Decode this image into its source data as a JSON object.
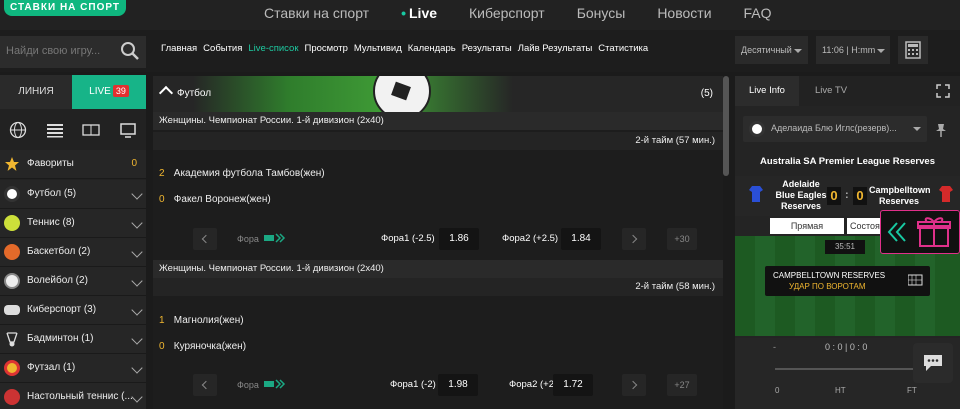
{
  "header": {
    "logo": "СТАВКИ НА СПОРТ",
    "nav": [
      "Ставки на спорт",
      "Live",
      "Киберспорт",
      "Бонусы",
      "Новости",
      "FAQ"
    ]
  },
  "search": {
    "placeholder": "Найди свою игру..."
  },
  "subnav": [
    "Главная",
    "События",
    "Live-список",
    "Просмотр",
    "Мультивид",
    "Календарь",
    "Результаты",
    "Лайв Результаты",
    "Статистика"
  ],
  "settings": {
    "odds_format": "Десятичный",
    "time_format": "11:06 | H:mm"
  },
  "sidebar": {
    "tab_line": "ЛИНИЯ",
    "tab_live": "LIVE",
    "live_count": "39",
    "sports": [
      {
        "name": "Фавориты",
        "count": "0",
        "icon": "star-icon"
      },
      {
        "name": "Футбол (5)",
        "icon": "football-icon"
      },
      {
        "name": "Теннис (8)",
        "icon": "tennis-icon"
      },
      {
        "name": "Баскетбол (2)",
        "icon": "basketball-icon"
      },
      {
        "name": "Волейбол (2)",
        "icon": "volleyball-icon"
      },
      {
        "name": "Киберспорт (3)",
        "icon": "gamepad-icon"
      },
      {
        "name": "Бадминтон (1)",
        "icon": "shuttlecock-icon"
      },
      {
        "name": "Футзал (1)",
        "icon": "futsal-icon"
      },
      {
        "name": "Настольный теннис (...",
        "icon": "table-tennis-icon"
      }
    ]
  },
  "main": {
    "sport_title": "Футбол",
    "sport_count": "(5)",
    "matches": [
      {
        "league": "Женщины. Чемпионат России. 1-й дивизион (2х40)",
        "period": "2-й тайм   (57 мин.)",
        "team1_score": "2",
        "team1": "Академия футбола Тамбов(жен)",
        "team2_score": "0",
        "team2": "Факел Воронеж(жен)",
        "market": "Фора",
        "h1_label": "Фора1 (-2.5)",
        "h1_odd": "1.86",
        "h2_label": "Фора2 (+2.5)",
        "h2_odd": "1.84",
        "more": "+30"
      },
      {
        "league": "Женщины. Чемпионат России. 1-й дивизион (2х40)",
        "period": "2-й тайм   (58 мин.)",
        "team1_score": "1",
        "team1": "Магнолия(жен)",
        "team2_score": "0",
        "team2": "Куряночка(жен)",
        "market": "Фора",
        "h1_label": "Фора1 (-2)",
        "h1_odd": "1.98",
        "h2_label": "Фора2 (+2)",
        "h2_odd": "1.72",
        "more": "+27"
      }
    ]
  },
  "right": {
    "tab_info": "Live Info",
    "tab_tv": "Live TV",
    "match_select": "Аделаида Блю Иглс(резерв)...",
    "competition": "Australia SA Premier League Reserves",
    "home": "Adelaide Blue Eagles Reserves",
    "away": "Campbelltown Reserves",
    "home_score": "0",
    "away_score": "0",
    "btn_direct": "Прямая",
    "btn_state": "Состояние",
    "clock": "35:51",
    "event_team": "CAMPBELLTOWN RESERVES",
    "event_text": "УДАР ПО ВОРОТАМ",
    "bottom_dash": "-",
    "bottom_score": "0 : 0 | 0 : 0",
    "tl_start": "0",
    "tl_ht": "HT",
    "tl_ft": "FT"
  },
  "colors": {
    "accent": "#17b488",
    "odds_score": "#f0b630",
    "badge": "#e23030",
    "gift": "#e0308a"
  }
}
